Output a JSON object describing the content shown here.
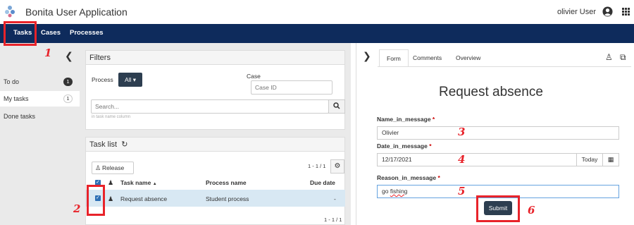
{
  "header": {
    "app_title": "Bonita User Application",
    "username": "olivier User",
    "icons": [
      "bonita-logo",
      "user-circle-icon",
      "apps-grid-icon"
    ]
  },
  "nav": {
    "items": [
      "Tasks",
      "Cases",
      "Processes"
    ],
    "bg_color": "#0e2b5c"
  },
  "sidebar": {
    "items": [
      {
        "label": "To do",
        "badge": "1"
      },
      {
        "label": "My tasks",
        "badge": "1"
      },
      {
        "label": "Done tasks",
        "badge": ""
      }
    ]
  },
  "filters": {
    "title": "Filters",
    "process_label": "Process",
    "process_value": "All ▾",
    "case_label": "Case",
    "case_placeholder": "Case ID",
    "search_placeholder": "Search...",
    "search_hint": "in task name column"
  },
  "task_list": {
    "title": "Task list",
    "release_label": "Release",
    "pager_top": "1 - 1 / 1",
    "pager_bottom": "1 - 1 / 1",
    "columns": [
      "Task name",
      "Process name",
      "Due date"
    ],
    "sort_indicator": "▲",
    "rows": [
      {
        "task": "Request absence",
        "process": "Student process",
        "due": "-"
      }
    ]
  },
  "form_panel": {
    "tabs": [
      "Form",
      "Comments",
      "Overview"
    ],
    "form_title": "Request absence",
    "fields": [
      {
        "label": "Name_in_message",
        "required": "*",
        "value": "Olivier"
      },
      {
        "label": "Date_in_message",
        "required": "*",
        "value": "12/17/2021"
      },
      {
        "label": "Reason_in_message",
        "required": "*",
        "value_pre": "go ",
        "value_mark": "fishing"
      }
    ],
    "today_label": "Today",
    "submit_label": "Submit"
  },
  "annotations": {
    "numbers": [
      "1",
      "2",
      "3",
      "4",
      "5",
      "6"
    ],
    "color": "#e8232a"
  }
}
